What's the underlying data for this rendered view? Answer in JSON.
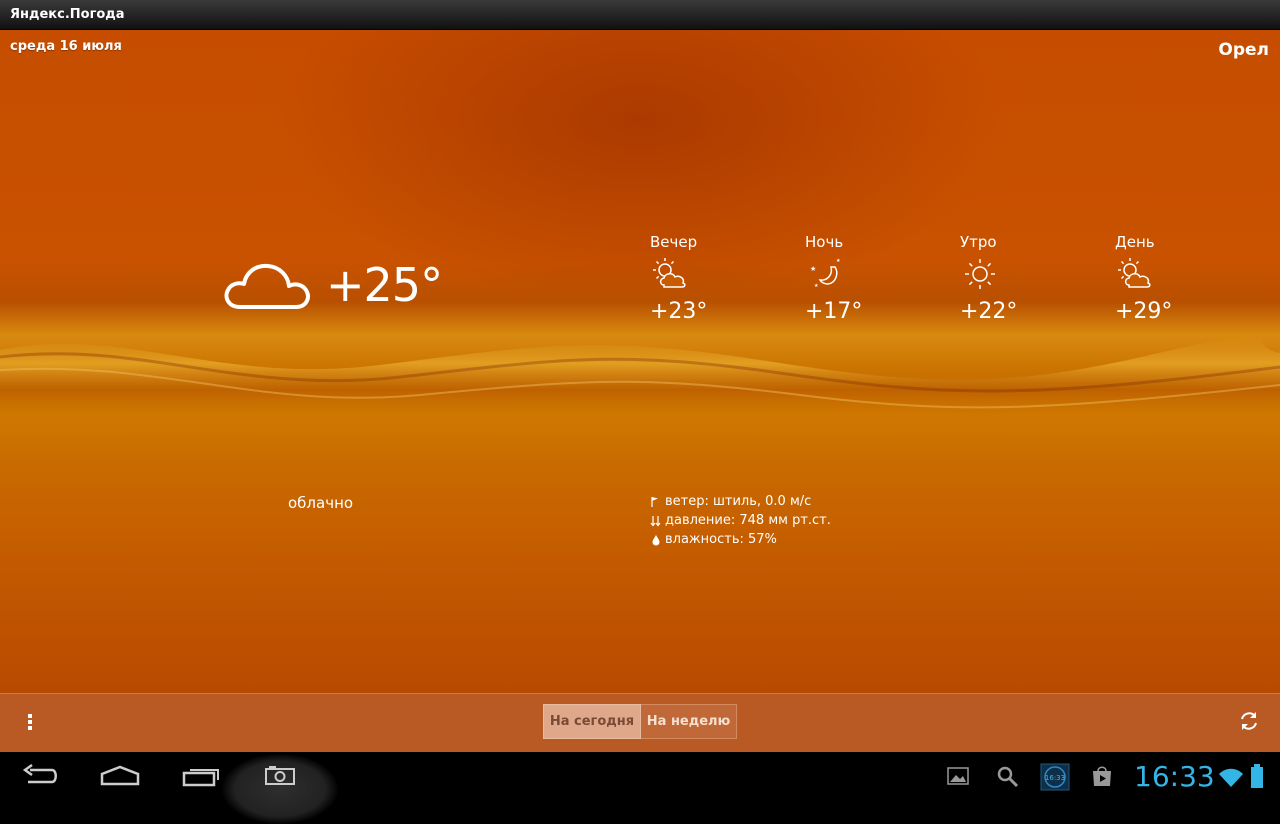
{
  "app": {
    "title": "Яндекс.Погода"
  },
  "header": {
    "date": "среда 16 июля",
    "city": "Орел"
  },
  "current": {
    "icon": "cloud-icon",
    "temperature": "+25°",
    "condition": "облачно"
  },
  "forecast": [
    {
      "label": "Вечер",
      "icon": "sun-cloud-icon",
      "temperature": "+23°"
    },
    {
      "label": "Ночь",
      "icon": "moon-stars-icon",
      "temperature": "+17°"
    },
    {
      "label": "Утро",
      "icon": "sun-icon",
      "temperature": "+22°"
    },
    {
      "label": "День",
      "icon": "sun-cloud-icon",
      "temperature": "+29°"
    }
  ],
  "details": {
    "wind": "ветер: штиль, 0.0 м/с",
    "pressure": "давление: 748 мм рт.ст.",
    "humidity": "влажность: 57%"
  },
  "bottom_bar": {
    "today_label": "На сегодня",
    "week_label": "На неделю",
    "active_tab": "На сегодня"
  },
  "system_bar": {
    "clock": "16:33",
    "widget_time": "16:33"
  },
  "colors": {
    "accent_clock": "#33b5e5",
    "background_orange": "#c85200",
    "tab_active": "#dfa88a"
  }
}
